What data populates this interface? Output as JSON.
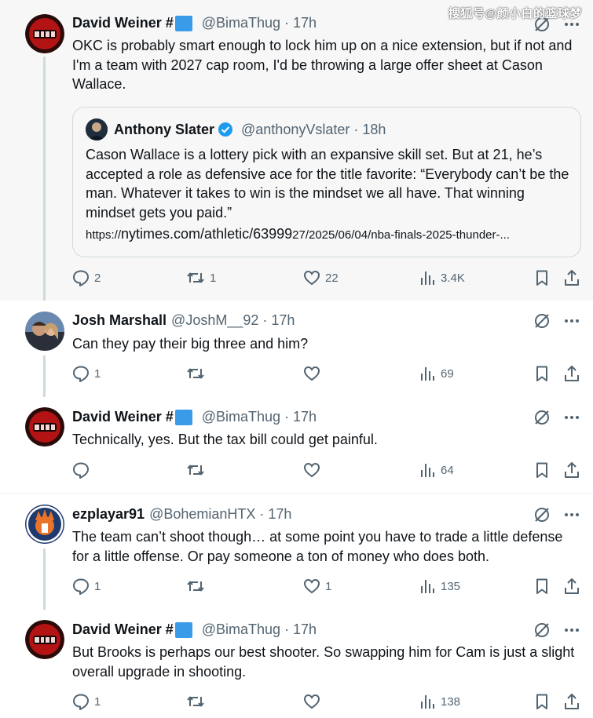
{
  "watermark": "搜狐号@颜小白的篮球梦",
  "tweets": [
    {
      "name": "David Weiner #",
      "handle": "@BimaThug",
      "time": "17h",
      "text": "OKC is probably smart enough to lock him up on a nice extension, but if not and I'm a team with 2027 cap room, I'd be throwing a large offer sheet at Cason Wallace.",
      "replies": "2",
      "retweets": "1",
      "likes": "22",
      "views": "3.4K"
    },
    {
      "name": "Josh Marshall",
      "handle": "@JoshM__92",
      "time": "17h",
      "text": "Can they pay their big three and him?",
      "replies": "1",
      "retweets": "",
      "likes": "",
      "views": "69"
    },
    {
      "name": "David Weiner #",
      "handle": "@BimaThug",
      "time": "17h",
      "text": "Technically, yes. But the tax bill could get painful.",
      "replies": "",
      "retweets": "",
      "likes": "",
      "views": "64"
    },
    {
      "name": "ezplayar91",
      "handle": "@BohemianHTX",
      "time": "17h",
      "text": "The team can’t shoot though… at some point you have to trade a little defense for a little offense. Or pay someone a ton of money who does both.",
      "replies": "1",
      "retweets": "",
      "likes": "1",
      "views": "135"
    },
    {
      "name": "David Weiner #",
      "handle": "@BimaThug",
      "time": "17h",
      "text": "But Brooks is perhaps our best shooter. So swapping him for Cam is just a slight overall upgrade in shooting.",
      "replies": "1",
      "retweets": "",
      "likes": "",
      "views": "138"
    }
  ],
  "quote": {
    "name": "Anthony Slater",
    "handle": "@anthonyVslater",
    "time": "18h",
    "text": "Cason Wallace is a lottery pick with an expansive skill set. But at 21, he’s accepted a role as defensive ace for the title favorite: “Everybody can’t be the man. Whatever it takes to win is the mindset we all have. That winning mindset gets you paid.”",
    "link_prefix": "https://",
    "link_main": "nytimes.com/athletic/63999",
    "link_rest": "27/2025/06/04/nba-finals-2025-thunder-..."
  },
  "colors": {
    "text": "#0f1419",
    "secondary": "#536471",
    "verified": "#1d9bf0",
    "border": "#cfd9de"
  }
}
